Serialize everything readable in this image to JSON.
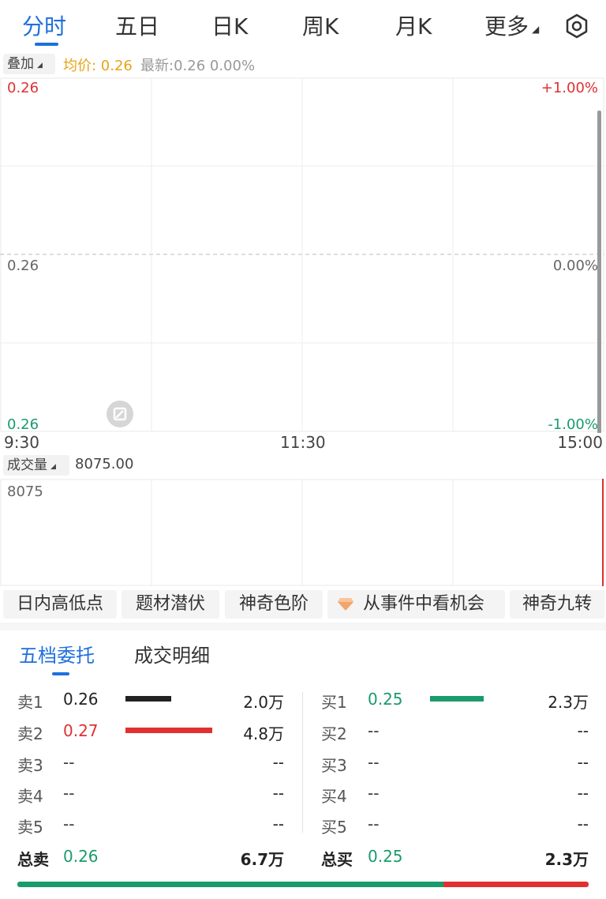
{
  "tabs": [
    {
      "label": "分时",
      "active": true
    },
    {
      "label": "五日"
    },
    {
      "label": "日K"
    },
    {
      "label": "周K"
    },
    {
      "label": "月K"
    },
    {
      "label": "更多"
    }
  ],
  "info": {
    "overlay_label": "叠加",
    "avg": "均价: 0.26",
    "latest": "最新:0.26 0.00%"
  },
  "chart": {
    "price_top": "0.26",
    "price_mid": "0.26",
    "price_bottom": "0.26",
    "pct_top": "+1.00%",
    "pct_mid": "0.00%",
    "pct_bottom": "-1.00%",
    "time_start": "9:30",
    "time_mid": "11:30",
    "time_end": "15:00"
  },
  "volume": {
    "label": "成交量",
    "value": "8075.00",
    "axis_top": "8075"
  },
  "chips": [
    "日内高低点",
    "题材潜伏",
    "神奇色阶",
    "从事件中看机会",
    "神奇九转"
  ],
  "orderbook": {
    "tabs": [
      "五档委托",
      "成交明细"
    ],
    "sell": [
      {
        "label": "卖1",
        "price": "0.26",
        "volume": "2.0万"
      },
      {
        "label": "卖2",
        "price": "0.27",
        "volume": "4.8万"
      },
      {
        "label": "卖3",
        "price": "--",
        "volume": "--"
      },
      {
        "label": "卖4",
        "price": "--",
        "volume": "--"
      },
      {
        "label": "卖5",
        "price": "--",
        "volume": "--"
      }
    ],
    "buy": [
      {
        "label": "买1",
        "price": "0.25",
        "volume": "2.3万"
      },
      {
        "label": "买2",
        "price": "--",
        "volume": "--"
      },
      {
        "label": "买3",
        "price": "--",
        "volume": "--"
      },
      {
        "label": "买4",
        "price": "--",
        "volume": "--"
      },
      {
        "label": "买5",
        "price": "--",
        "volume": "--"
      }
    ],
    "total_sell": {
      "label": "总卖",
      "price": "0.26",
      "volume": "6.7万"
    },
    "total_buy": {
      "label": "总买",
      "price": "0.25",
      "volume": "2.3万"
    },
    "sell_bar_fractions": [
      0.42,
      1.0
    ],
    "buy_bar_fractions": [
      0.6
    ],
    "buy_ratio": 0.745
  },
  "colors": {
    "accent": "#1f6fdc",
    "up": "#e03131",
    "down": "#1a9b6c",
    "avg": "#e8a317"
  },
  "icons": {
    "settings": "gear-icon",
    "edit": "pencil-icon"
  }
}
